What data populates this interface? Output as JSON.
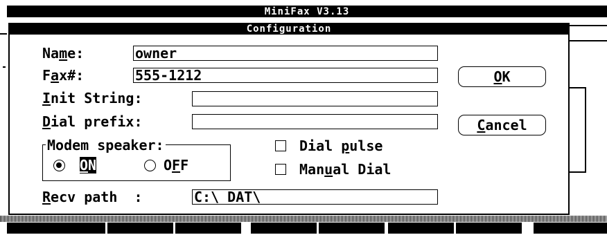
{
  "app": {
    "title": "MiniFax  V3.13"
  },
  "dialog": {
    "title": "Configuration",
    "fields": {
      "name": {
        "label": "Name:",
        "value": "owner"
      },
      "fax": {
        "label": "Fax#:",
        "value": "555-1212"
      },
      "init": {
        "label": "Init String:",
        "value": ""
      },
      "dial_prefix": {
        "label": "Dial prefix:",
        "value": ""
      },
      "recv_path": {
        "label": "Recv path  :",
        "value": "C:\\_DAT\\"
      }
    },
    "modem_speaker": {
      "label": "Modem speaker:",
      "options": [
        {
          "label": "ON",
          "selected": true
        },
        {
          "label": "OFF",
          "selected": false
        }
      ]
    },
    "checkboxes": [
      {
        "label": "Dial pulse",
        "checked": false
      },
      {
        "label": "Manual Dial",
        "checked": false
      }
    ],
    "buttons": {
      "ok": "OK",
      "cancel": "Cancel"
    }
  }
}
